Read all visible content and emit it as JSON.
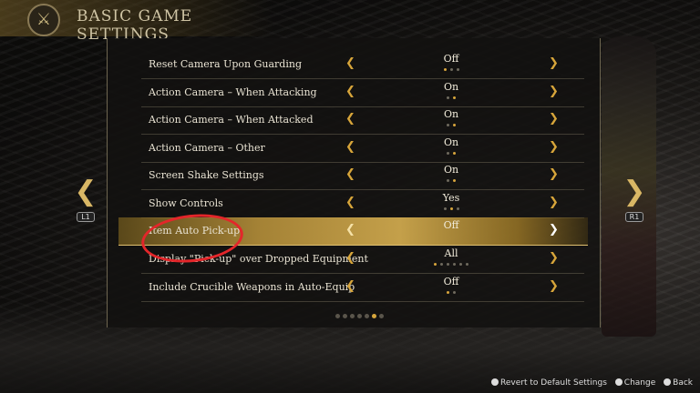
{
  "header": {
    "title": "BASIC GAME SETTINGS",
    "emblem": "crossed-swords-icon"
  },
  "settings": [
    {
      "label": "Reset Camera Upon Guarding",
      "value": "Off",
      "dots": 3,
      "active": 0
    },
    {
      "label": "Action Camera – When Attacking",
      "value": "On",
      "dots": 2,
      "active": 1
    },
    {
      "label": "Action Camera – When Attacked",
      "value": "On",
      "dots": 2,
      "active": 1
    },
    {
      "label": "Action Camera – Other",
      "value": "On",
      "dots": 2,
      "active": 1
    },
    {
      "label": "Screen Shake Settings",
      "value": "On",
      "dots": 2,
      "active": 1
    },
    {
      "label": "Show Controls",
      "value": "Yes",
      "dots": 3,
      "active": 1
    },
    {
      "label": "Item Auto Pick-up",
      "value": "Off",
      "dots": 0,
      "active": 0,
      "selected": true
    },
    {
      "label": "Display \"Pick-up\" over Dropped Equipment",
      "value": "All",
      "dots": 6,
      "active": 0
    },
    {
      "label": "Include Crucible Weapons in Auto-Equip",
      "value": "Off",
      "dots": 2,
      "active": 0
    }
  ],
  "pagination": {
    "total": 7,
    "current": 6
  },
  "nav": {
    "left_button": "L1",
    "right_button": "R1"
  },
  "footer": {
    "revert": "Revert to Default Settings",
    "change": "Change",
    "back": "Back"
  },
  "colors": {
    "accent": "#d8a53c",
    "annotation": "#e3262a"
  }
}
